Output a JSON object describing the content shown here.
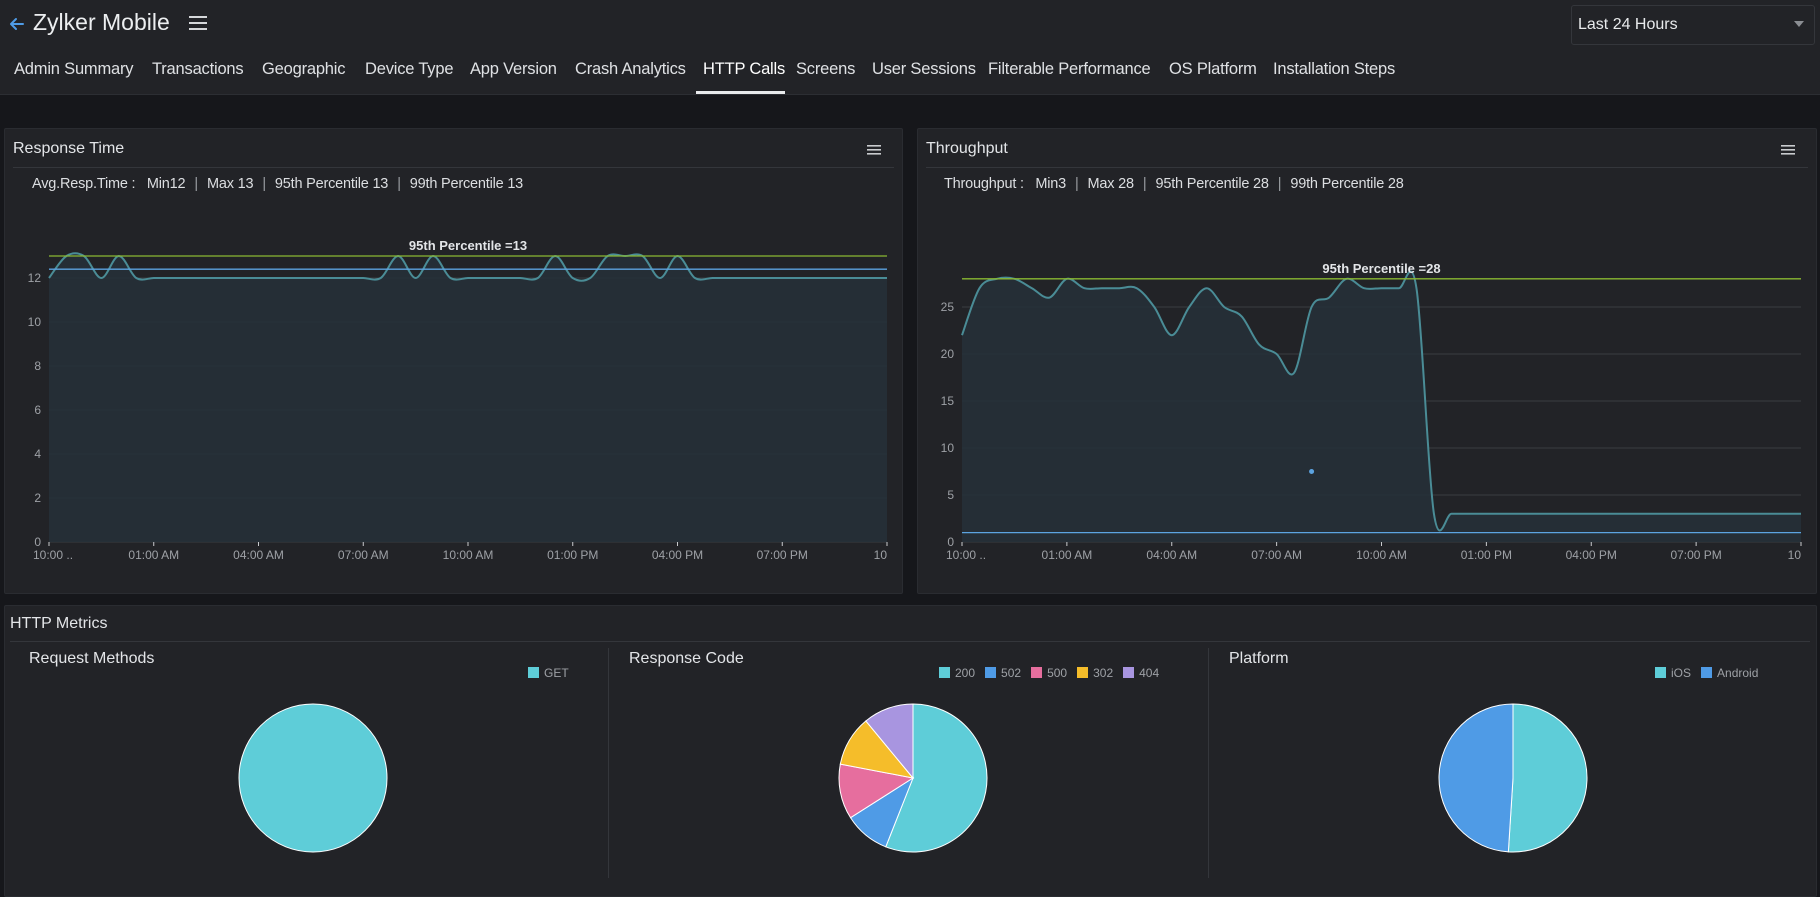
{
  "header": {
    "app_title": "Zylker Mobile",
    "time_range": "Last 24 Hours"
  },
  "tabs": [
    "Admin Summary",
    "Transactions",
    "Geographic",
    "Device Type",
    "App Version",
    "Crash Analytics",
    "HTTP Calls",
    "Screens",
    "User Sessions",
    "Filterable Performance",
    "OS Platform",
    "Installation Steps"
  ],
  "active_tab": "HTTP Calls",
  "response_time": {
    "title": "Response Time",
    "stats_label": "Avg.Resp.Time :",
    "stats": [
      "Min12",
      "Max 13",
      "95th Percentile 13",
      "99th Percentile 13"
    ],
    "percentile_label": "95th Percentile =13"
  },
  "throughput": {
    "title": "Throughput",
    "stats_label": "Throughput :",
    "stats": [
      "Min3",
      "Max 28",
      "95th Percentile 28",
      "99th Percentile 28"
    ],
    "percentile_label": "95th Percentile =28"
  },
  "http_metrics": {
    "title": "HTTP Metrics",
    "request_methods": {
      "title": "Request Methods"
    },
    "response_code": {
      "title": "Response Code"
    },
    "platform": {
      "title": "Platform"
    }
  },
  "colors": {
    "line": "#4a8c96",
    "area": "#263038",
    "percentile": "#8ab832",
    "avg": "#5ca3e0",
    "teal": "#5ecdd8",
    "blue": "#4f9be6",
    "pink": "#e66e9e",
    "yellow": "#f5bd2a",
    "purple": "#a895e0"
  },
  "chart_data": [
    {
      "type": "area",
      "title": "Response Time",
      "x_ticks": [
        "10:00 ..",
        "01:00 AM",
        "04:00 AM",
        "07:00 AM",
        "10:00 AM",
        "01:00 PM",
        "04:00 PM",
        "07:00 PM",
        "10"
      ],
      "y_ticks": [
        "0",
        "2",
        "4",
        "6",
        "8",
        "10",
        "12"
      ],
      "ylim": [
        0,
        13.5
      ],
      "x": [
        0,
        0.5,
        1,
        1.5,
        2,
        2.5,
        3,
        3.5,
        4,
        4.5,
        5,
        5.5,
        6,
        6.5,
        7,
        7.5,
        8,
        8.5,
        9,
        9.5,
        10,
        10.5,
        11,
        11.5,
        12,
        12.5,
        13,
        13.5,
        14,
        14.5,
        15,
        15.5,
        16,
        16.5,
        17,
        17.5,
        18,
        18.5,
        19,
        19.5,
        20,
        20.5,
        21,
        21.5,
        22,
        22.5,
        23,
        23.5,
        24
      ],
      "series": [
        {
          "values": [
            12,
            13,
            13,
            12,
            13,
            12,
            12,
            12,
            12,
            12,
            12,
            12,
            12,
            12,
            12,
            12,
            12,
            12,
            12,
            12,
            13,
            12,
            13,
            12,
            12,
            12,
            12,
            12,
            12,
            13,
            12,
            12,
            13,
            13,
            13,
            12,
            13,
            12,
            12,
            12,
            12,
            12,
            12,
            12,
            12,
            12,
            12,
            12,
            12
          ]
        }
      ],
      "reference_lines": [
        {
          "label": "95th Percentile =13",
          "value": 13
        },
        {
          "value": 12.4
        }
      ]
    },
    {
      "type": "area",
      "title": "Throughput",
      "x_ticks": [
        "10:00 ..",
        "01:00 AM",
        "04:00 AM",
        "07:00 AM",
        "10:00 AM",
        "01:00 PM",
        "04:00 PM",
        "07:00 PM",
        "10"
      ],
      "y_ticks": [
        "0",
        "5",
        "10",
        "15",
        "20",
        "25"
      ],
      "ylim": [
        0,
        30
      ],
      "x": [
        0,
        0.5,
        1,
        1.5,
        2,
        2.5,
        3,
        3.5,
        4,
        4.5,
        5,
        5.5,
        6,
        6.5,
        7,
        7.5,
        8,
        8.5,
        9,
        9.5,
        10,
        10.5,
        11,
        11.5,
        12,
        12.5,
        13,
        13.5,
        14,
        14.5,
        15,
        15.5,
        16,
        16.5,
        17,
        17.5,
        18,
        18.5,
        19,
        19.5,
        20,
        20.5,
        21,
        21.5,
        22,
        22.5,
        23,
        23.5,
        24
      ],
      "series": [
        {
          "values": [
            22,
            27,
            28,
            28,
            27,
            26,
            28,
            27,
            27,
            27,
            27,
            25,
            22,
            25,
            27,
            25,
            24,
            21,
            20,
            18,
            25,
            26,
            28,
            27,
            27,
            27,
            27,
            3,
            3,
            3,
            3,
            3,
            3,
            3,
            3,
            3,
            3,
            3,
            3,
            3,
            3,
            3,
            3,
            3,
            3,
            3,
            3,
            3,
            3
          ]
        }
      ],
      "reference_lines": [
        {
          "label": "95th Percentile =28",
          "value": 28
        },
        {
          "value": 1
        }
      ],
      "points": [
        {
          "x": 10,
          "y": 7.5
        }
      ]
    },
    {
      "type": "pie",
      "title": "Request Methods",
      "legend": [
        "GET"
      ],
      "slices": [
        {
          "label": "GET",
          "value": 100,
          "color": "#5ecdd8"
        }
      ]
    },
    {
      "type": "pie",
      "title": "Response Code",
      "legend": [
        "200",
        "502",
        "500",
        "302",
        "404"
      ],
      "slices": [
        {
          "label": "200",
          "value": 56,
          "color": "#5ecdd8"
        },
        {
          "label": "502",
          "value": 10,
          "color": "#4f9be6"
        },
        {
          "label": "500",
          "value": 12,
          "color": "#e66e9e"
        },
        {
          "label": "302",
          "value": 11,
          "color": "#f5bd2a"
        },
        {
          "label": "404",
          "value": 11,
          "color": "#a895e0"
        }
      ]
    },
    {
      "type": "pie",
      "title": "Platform",
      "legend": [
        "iOS",
        "Android"
      ],
      "slices": [
        {
          "label": "iOS",
          "value": 51,
          "color": "#5ecdd8"
        },
        {
          "label": "Android",
          "value": 49,
          "color": "#4f9be6"
        }
      ]
    }
  ]
}
